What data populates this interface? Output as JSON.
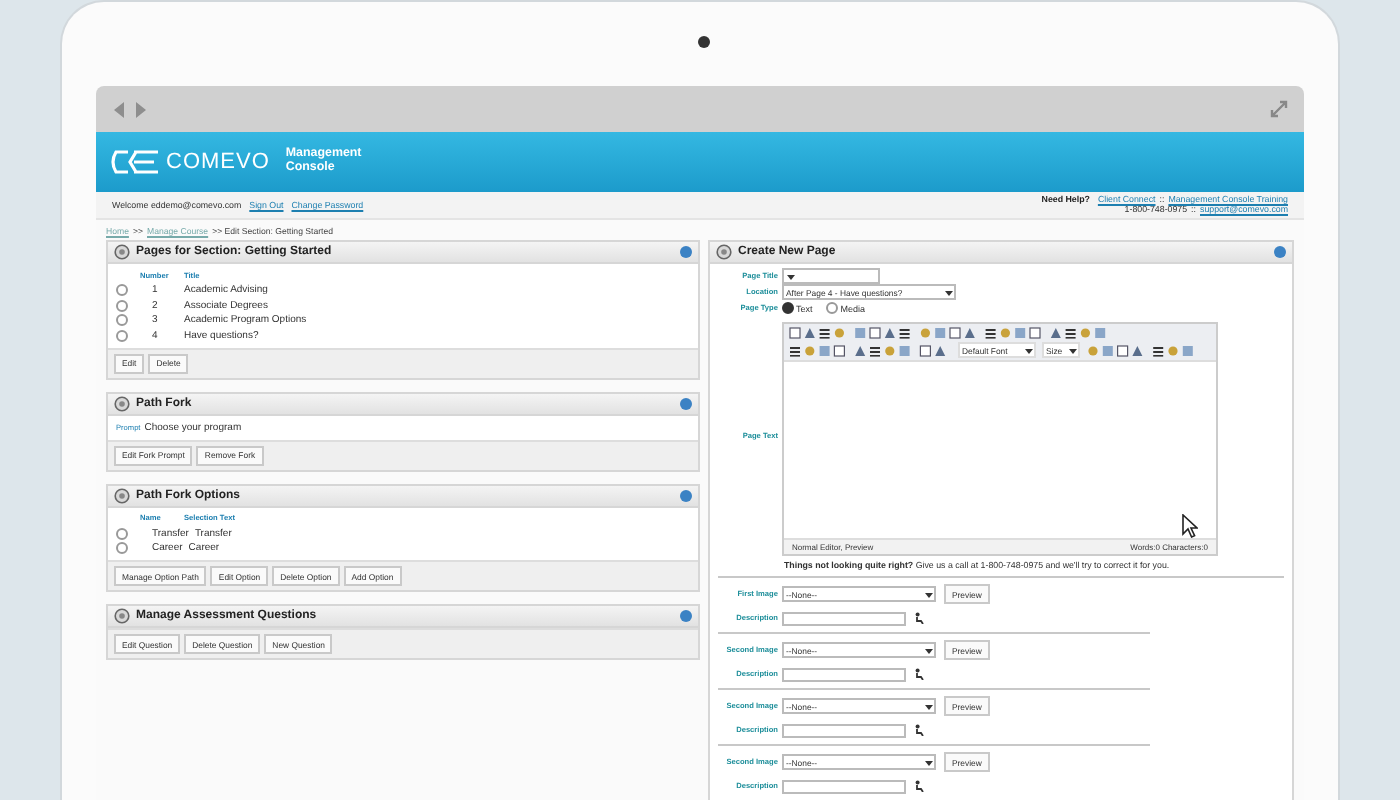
{
  "header": {
    "logo": "COMEVO",
    "product": "Management Console"
  },
  "user_bar": {
    "welcome": "Welcome eddemo@comevo.com",
    "links": [
      "Sign Out",
      "Change Password"
    ],
    "help_label": "Need Help?",
    "help_lines": [
      [
        {
          "kind": "link",
          "text": "Client Connect"
        },
        {
          "kind": "text",
          "text": "::"
        },
        {
          "kind": "link",
          "text": "Management Console Training"
        }
      ],
      [
        {
          "kind": "text",
          "text": "1-800-748-0975"
        },
        {
          "kind": "text",
          "text": "::"
        },
        {
          "kind": "link",
          "text": "support@comevo.com"
        }
      ]
    ]
  },
  "breadcrumb": [
    {
      "kind": "link",
      "text": "Home"
    },
    {
      "kind": "text",
      "text": ">>"
    },
    {
      "kind": "link",
      "text": "Manage Course"
    },
    {
      "kind": "text",
      "text": ">> Edit Section: Getting Started"
    }
  ],
  "left_panels": [
    {
      "title": "Pages for Section: Getting Started",
      "columns": [
        "Number",
        "Title"
      ],
      "rows": [
        {
          "cells": [
            "1",
            "Academic Advising"
          ],
          "selected": false
        },
        {
          "cells": [
            "2",
            "Associate Degrees"
          ],
          "selected": false
        },
        {
          "cells": [
            "3",
            "Academic Program Options"
          ],
          "selected": false
        },
        {
          "cells": [
            "4",
            "Have questions?"
          ],
          "selected": false
        }
      ],
      "buttons": [
        "Edit",
        "Delete"
      ]
    },
    {
      "title": "Path Fork",
      "prompt_label": "Prompt",
      "prompt": "Choose your program",
      "buttons": [
        "Edit Fork Prompt",
        "Remove Fork"
      ]
    },
    {
      "title": "Path Fork Options",
      "columns": [
        "Name",
        "Selection Text"
      ],
      "rows": [
        {
          "cells": [
            "Transfer",
            "Transfer"
          ],
          "selected": false
        },
        {
          "cells": [
            "Career",
            "Career"
          ],
          "selected": false
        }
      ],
      "buttons": [
        "Manage Option Path",
        "Edit Option",
        "Delete Option",
        "Add Option"
      ]
    },
    {
      "title": "Manage Assessment Questions",
      "buttons": [
        "Edit Question",
        "Delete Question",
        "New Question"
      ]
    }
  ],
  "create_page": {
    "title": "Create New Page",
    "page_title": {
      "label": "Page Title"
    },
    "location": {
      "label": "Location",
      "value": "After Page 4 - Have questions?"
    },
    "page_type": {
      "label": "Page Type",
      "options": [
        {
          "label": "Text",
          "selected": true
        },
        {
          "label": "Media",
          "selected": false
        }
      ]
    },
    "page_text": {
      "label": "Page Text",
      "font": "Default Font",
      "size": "Size",
      "mode": "Normal Editor, Preview",
      "counts": "Words:0 Characters:0"
    },
    "note": "**Things not looking quite right?** Give us a call at 1-800-748-0975 and we'll try to correct it for you.",
    "images": [
      {
        "label": "First Image",
        "value": "--None--",
        "button": "Preview",
        "description_label": "Description"
      },
      {
        "label": "Second Image",
        "value": "--None--",
        "button": "Preview",
        "description_label": "Description"
      },
      {
        "label": "Second Image",
        "value": "--None--",
        "button": "Preview",
        "description_label": "Description"
      },
      {
        "label": "Second Image",
        "value": "--None--",
        "button": "Preview",
        "description_label": "Description"
      }
    ]
  }
}
